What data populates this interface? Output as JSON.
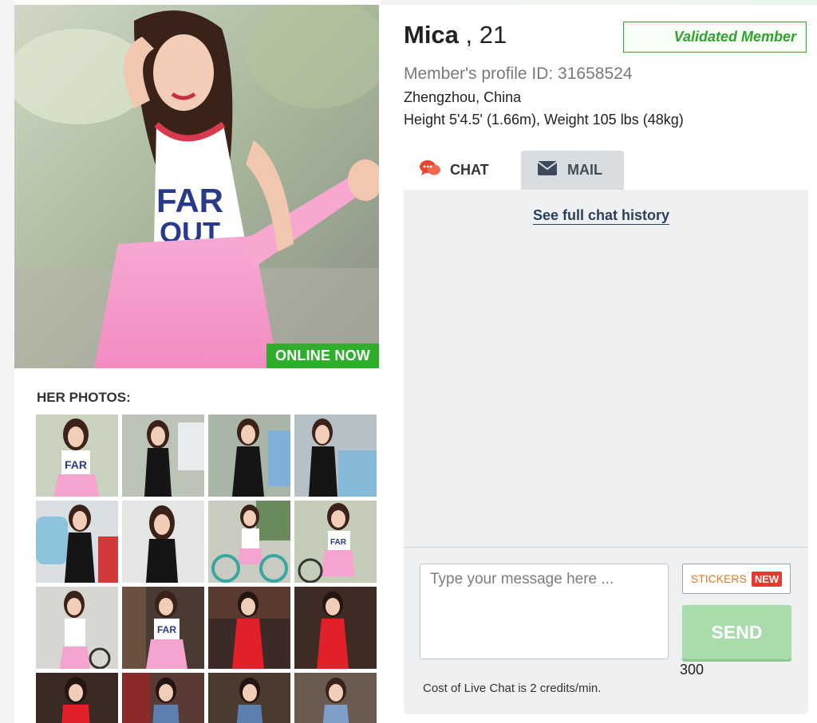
{
  "profile": {
    "name": "Mica",
    "age_sep": ",",
    "age": "21",
    "validated_label": "Validated Member",
    "profile_id_text": "Member's profile ID: 31658524",
    "location": "Zhengzhou, China",
    "measurements": "Height 5'4.5' (1.66m), Weight 105 lbs (48kg)"
  },
  "main_photo": {
    "online_badge": "ONLINE NOW"
  },
  "photos": {
    "heading": "HER PHOTOS:",
    "thumbnails": [
      {
        "outfit": "pink-overalls"
      },
      {
        "outfit": "black-dress"
      },
      {
        "outfit": "black-dress"
      },
      {
        "outfit": "black-dress-car"
      },
      {
        "outfit": "black-dress-car"
      },
      {
        "outfit": "black-dress"
      },
      {
        "outfit": "white-top-bicycle"
      },
      {
        "outfit": "pink-overalls-bicycle"
      },
      {
        "outfit": "white-top"
      },
      {
        "outfit": "pink-overalls"
      },
      {
        "outfit": "red-dress"
      },
      {
        "outfit": "red-dress"
      },
      {
        "outfit": "red-dress"
      },
      {
        "outfit": "blue-dress"
      },
      {
        "outfit": "blue-dress"
      },
      {
        "outfit": "blue-dress"
      }
    ]
  },
  "tabs": {
    "chat_label": "CHAT",
    "mail_label": "MAIL",
    "active": "chat"
  },
  "chat": {
    "history_link": "See full chat history",
    "input_placeholder": "Type your message here ...",
    "stickers_label": "STICKERS",
    "new_badge": "NEW",
    "send_label": "SEND",
    "char_count": "300",
    "cost_note": "Cost of Live Chat is 2 credits/min."
  },
  "colors": {
    "online_green": "#2fae2c",
    "validated_green": "#2fa32c",
    "send_green": "#a9dcaa",
    "new_red": "#e63a2e",
    "stickers_orange": "#e07b1d",
    "panel_bg": "#eef0f2"
  },
  "icons": {
    "chat_tab": "chat-bubbles-icon",
    "mail_tab": "envelope-icon"
  }
}
